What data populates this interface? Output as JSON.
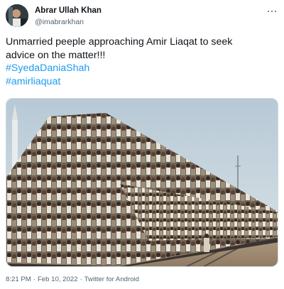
{
  "author": {
    "display_name": "Abrar Ullah Khan",
    "handle": "@imabrarkhan"
  },
  "tweet": {
    "text_line1": "Unmarried peeple approaching Amir Liaqat to seek",
    "text_line2": "advice on the matter!!!",
    "hashtags": [
      "#SyedaDaniaShah",
      "#amirliaquat"
    ]
  },
  "meta": {
    "time": "8:21 PM",
    "separator": "·",
    "date": "Feb 10, 2022",
    "source": "Twitter for Android"
  },
  "icons": {
    "more": "more-horizontal-icon",
    "avatar": "avatar"
  },
  "colors": {
    "text": "#0f1419",
    "secondary": "#536471",
    "link": "#1d9bf0"
  }
}
